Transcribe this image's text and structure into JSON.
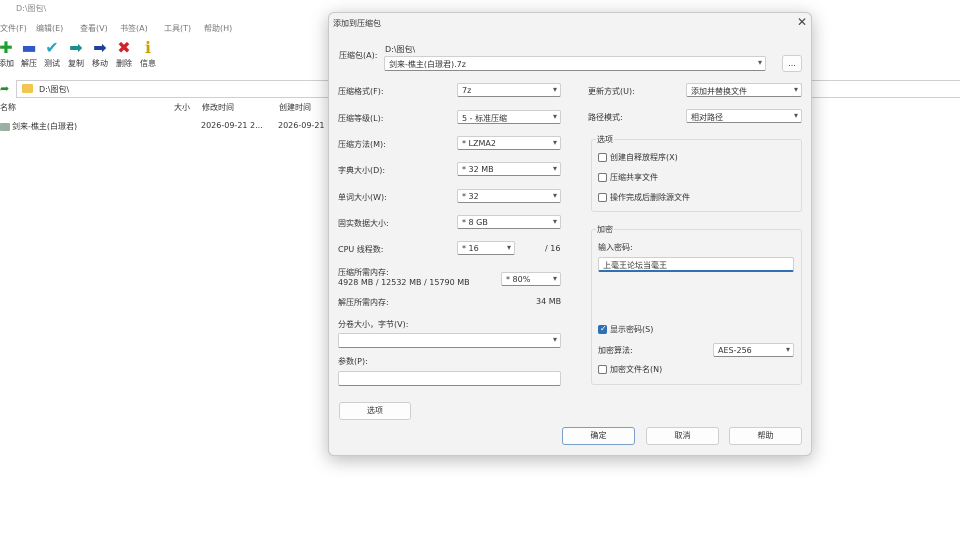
{
  "main": {
    "title": "D:\\图包\\",
    "menu": [
      "文件(F)",
      "编辑(E)",
      "查看(V)",
      "书签(A)",
      "工具(T)",
      "帮助(H)"
    ],
    "toolbar": [
      {
        "label": "添加",
        "icon": "plus-icon",
        "glyph": "✚",
        "color": "#1e9e2a"
      },
      {
        "label": "解压",
        "icon": "minus-icon",
        "glyph": "▬",
        "color": "#2f58c9"
      },
      {
        "label": "测试",
        "icon": "check-icon",
        "glyph": "✔",
        "color": "#2aa7c0"
      },
      {
        "label": "复制",
        "icon": "copy-arrow-icon",
        "glyph": "➡",
        "color": "#1b8f8f"
      },
      {
        "label": "移动",
        "icon": "move-arrow-icon",
        "glyph": "➡",
        "color": "#1f3f9e"
      },
      {
        "label": "删除",
        "icon": "delete-x-icon",
        "glyph": "✖",
        "color": "#d0242a"
      },
      {
        "label": "信息",
        "icon": "info-icon",
        "glyph": "ℹ",
        "color": "#c9a400"
      }
    ],
    "address": "D:\\图包\\",
    "columns": [
      "名称",
      "大小",
      "修改时间",
      "创建时间"
    ],
    "files": [
      {
        "name": "剑来-樵主(白璟君)",
        "modified": "2026-09-21 2...",
        "created": "2026-09-21"
      }
    ]
  },
  "dialog": {
    "title": "添加到压缩包",
    "close_glyph": "✕",
    "archive_label": "压缩包(A):",
    "archive_dir": "D:\\图包\\",
    "archive_name": "剑来-樵主(白璟君).7z",
    "browse_label": "...",
    "format_label": "压缩格式(F):",
    "format_value": "7z",
    "level_label": "压缩等级(L):",
    "level_value": "5 - 标准压缩",
    "method_label": "压缩方法(M):",
    "method_value": "* LZMA2",
    "dict_label": "字典大小(D):",
    "dict_value": "* 32 MB",
    "word_label": "单词大小(W):",
    "word_value": "* 32",
    "solid_label": "固实数据大小:",
    "solid_value": "* 8 GB",
    "cpu_label": "CPU 线程数:",
    "cpu_value": "* 16",
    "cpu_total": "/ 16",
    "mem_label": "压缩所需内存:",
    "mem_detail": "4928 MB / 12532 MB / 15790 MB",
    "mem_value": "* 80%",
    "demem_label": "解压所需内存:",
    "demem_value": "34 MB",
    "split_label": "分卷大小，字节(V):",
    "split_value": "",
    "params_label": "参数(P):",
    "params_value": "",
    "options_button": "选项",
    "update_label": "更新方式(U):",
    "update_value": "添加并替换文件",
    "path_label": "路径模式:",
    "path_value": "相对路径",
    "options_group": "选项",
    "opt_sfx": "创建自释放程序(X)",
    "opt_shared": "压缩共享文件",
    "opt_delete": "操作完成后删除源文件",
    "encrypt_group": "加密",
    "password_label": "输入密码:",
    "password_value": "上毫王论坛当毫王",
    "show_password": "显示密码(S)",
    "enc_method_label": "加密算法:",
    "enc_method_value": "AES-256",
    "encrypt_names": "加密文件名(N)",
    "ok": "确定",
    "cancel": "取消",
    "help": "帮助"
  }
}
